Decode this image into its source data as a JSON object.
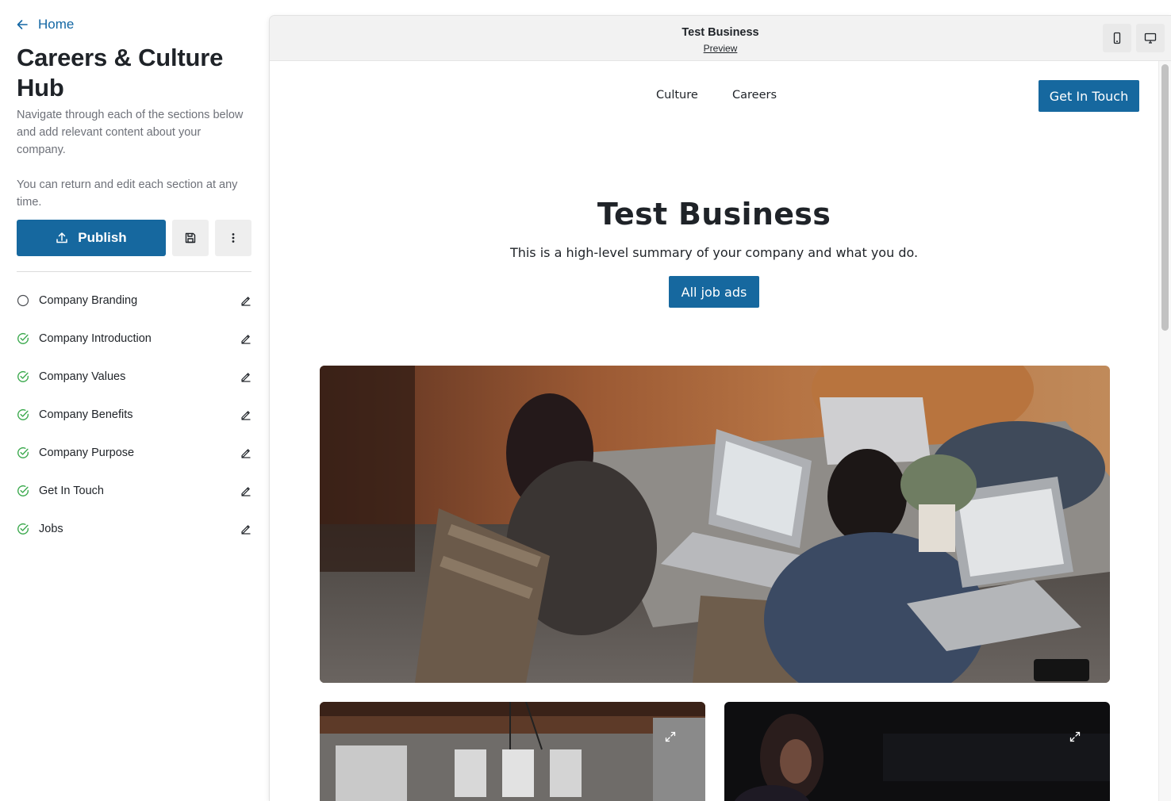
{
  "sidebar": {
    "back_label": "Home",
    "title": "Careers & Culture Hub",
    "description_1": "Navigate through each of the sections below and add relevant content about your company.",
    "description_2": "You can return and edit each section at any time.",
    "publish_label": "Publish",
    "save_icon": "save-icon",
    "more_icon": "more-vertical-icon",
    "steps": [
      {
        "label": "Company Branding",
        "status": "incomplete"
      },
      {
        "label": "Company Introduction",
        "status": "complete"
      },
      {
        "label": "Company Values",
        "status": "complete"
      },
      {
        "label": "Company Benefits",
        "status": "complete"
      },
      {
        "label": "Company Purpose",
        "status": "complete"
      },
      {
        "label": "Get In Touch",
        "status": "complete"
      },
      {
        "label": "Jobs",
        "status": "complete"
      }
    ]
  },
  "preview": {
    "title": "Test Business",
    "subtitle": "Preview",
    "devices": [
      "mobile-icon",
      "desktop-icon"
    ]
  },
  "site": {
    "nav": {
      "links": [
        "Culture",
        "Careers"
      ],
      "cta_label": "Get In Touch"
    },
    "hero": {
      "heading": "Test Business",
      "summary": "This is a high-level summary of your company and what you do.",
      "button_label": "All job ads"
    }
  },
  "colors": {
    "primary": "#16689f",
    "link": "#1367a4",
    "complete": "#3daa4f"
  }
}
